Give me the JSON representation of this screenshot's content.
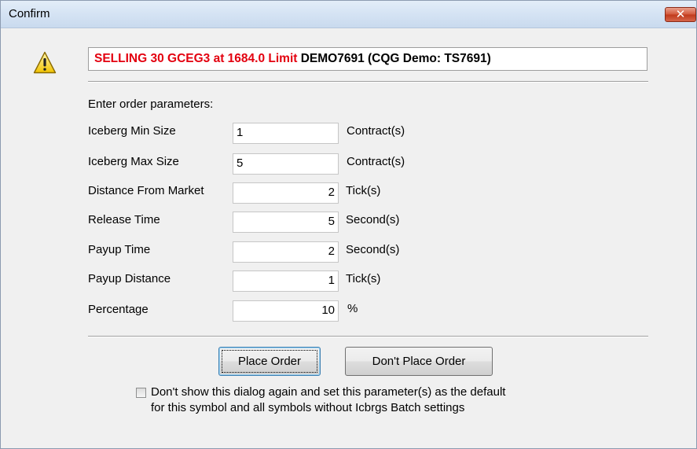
{
  "window": {
    "title": "Confirm",
    "close_label": "✕"
  },
  "order": {
    "action_text": "SELLING 30 GCEG3 at 1684.0 Limit",
    "account_text": "DEMO7691 (CQG Demo: TS7691)"
  },
  "form": {
    "header": "Enter order parameters:",
    "fields": [
      {
        "label": "Iceberg Min Size",
        "value": "1",
        "unit": "Contract(s)"
      },
      {
        "label": "Iceberg Max Size",
        "value": "5",
        "unit": "Contract(s)"
      },
      {
        "label": "Distance From Market",
        "value": "2",
        "unit": "Tick(s)"
      },
      {
        "label": "Release Time",
        "value": "5",
        "unit": "Second(s)"
      },
      {
        "label": "Payup Time",
        "value": "2",
        "unit": "Second(s)"
      },
      {
        "label": "Payup Distance",
        "value": "1",
        "unit": "Tick(s)"
      },
      {
        "label": "Percentage",
        "value": "10",
        "unit": "%"
      }
    ]
  },
  "buttons": {
    "place": "Place Order",
    "dont_place": "Don't Place Order"
  },
  "checkbox": {
    "checked": false,
    "line1": "Don't show this dialog again and set this parameter(s) as the default",
    "line2": "for this symbol and all symbols without Icbrgs Batch settings"
  },
  "icons": {
    "warning": "warning-icon",
    "close": "close-icon",
    "checkbox": "checkbox-icon"
  }
}
